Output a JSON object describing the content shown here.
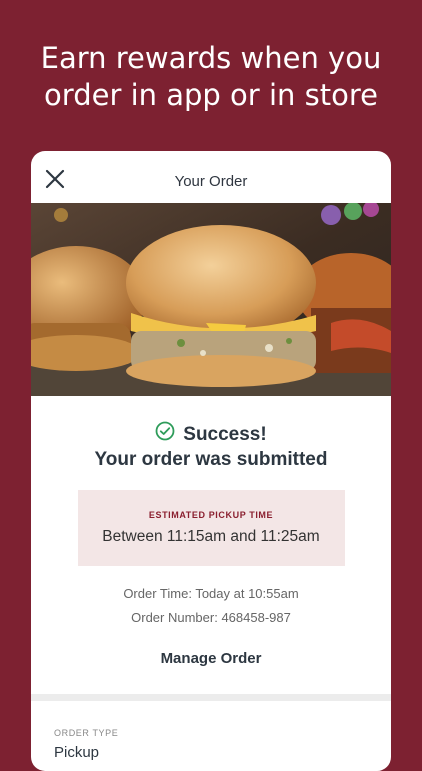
{
  "promo": {
    "line1": "Earn rewards when you",
    "line2": "order in app or in store"
  },
  "header": {
    "title": "Your Order",
    "close_icon": "close-icon"
  },
  "status": {
    "icon": "check-circle-icon",
    "headline": "Success!",
    "subline": "Your order was submitted"
  },
  "pickup": {
    "label": "ESTIMATED PICKUP TIME",
    "value": "Between 11:15am and 11:25am"
  },
  "order_info": {
    "order_time": "Order Time: Today at 10:55am",
    "order_number": "Order Number: 468458-987"
  },
  "actions": {
    "manage_label": "Manage Order"
  },
  "details": {
    "order_type_label": "ORDER TYPE",
    "order_type_value": "Pickup"
  },
  "colors": {
    "brand": "#7d2131",
    "success": "#2e9c5a",
    "pickup_bg": "#f3e6e6"
  }
}
